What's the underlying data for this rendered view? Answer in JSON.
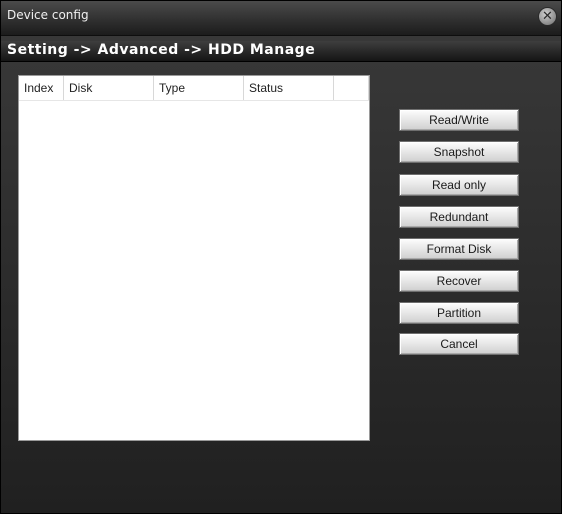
{
  "window": {
    "title": "Device config",
    "close_glyph": "✕"
  },
  "breadcrumb": {
    "text": "Setting -> Advanced -> HDD Manage"
  },
  "table": {
    "columns": [
      "Index",
      "Disk",
      "Type",
      "Status",
      ""
    ],
    "rows": []
  },
  "buttons": {
    "read_write": "Read/Write",
    "snapshot": "Snapshot",
    "read_only": "Read only",
    "redundant": "Redundant",
    "format_disk": "Format Disk",
    "recover": "Recover",
    "partition": "Partition",
    "cancel": "Cancel"
  }
}
